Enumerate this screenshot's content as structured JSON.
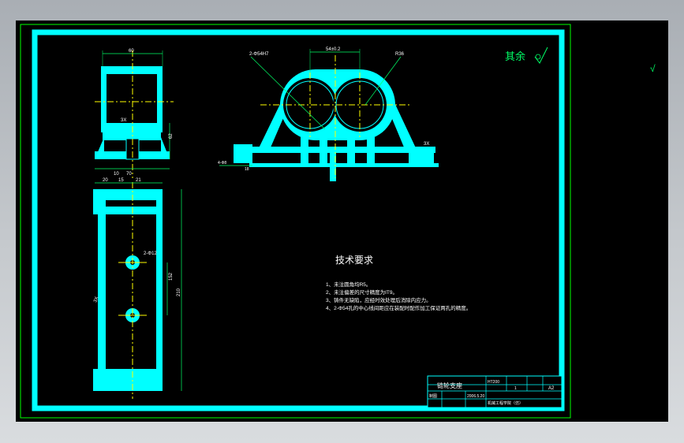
{
  "colors": {
    "viewport_bg": "#000000",
    "frame": "#00ffff",
    "outline": "#00ff00",
    "center_line": "#ffff00",
    "dimension": "#00ff66",
    "text": "#ffffff"
  },
  "roughness_note": "其余",
  "technical_requirements": {
    "title": "技术要求",
    "items": [
      "1、未注圆角均R5。",
      "2、未注偏差的尺寸精度为IT9。",
      "3、铸件无缺陷，应经时效处理后消除内应力。",
      "4、2-Φ54孔的中心线间距应在装配时配作加工保证两孔的精度。"
    ]
  },
  "dimensions": {
    "top_view_width": "60",
    "bottom_widths": [
      "10",
      "70"
    ],
    "side_height": "62",
    "chamfer_1": "3X",
    "front_hole_callout": "2-Φ54H7",
    "front_center_distance": "54±0.2",
    "front_radius": "R36",
    "front_bottom_callout": "4-Φ8",
    "front_small_dim": "18",
    "front_chamfer": "3X",
    "plan_widths": [
      "20",
      "15",
      "21"
    ],
    "plan_hole_callout": "2-Φ12",
    "plan_total_height": "210",
    "plan_mid_height": "152",
    "plan_chamfer": "3X"
  },
  "title_block": {
    "name": "链轮支座",
    "row2": [
      "制图",
      "",
      "2006.5.20"
    ],
    "material": "HT200",
    "scale": "1",
    "sheet": "A2",
    "school": "机械工程学院（仿）"
  },
  "side_symbol": "√"
}
